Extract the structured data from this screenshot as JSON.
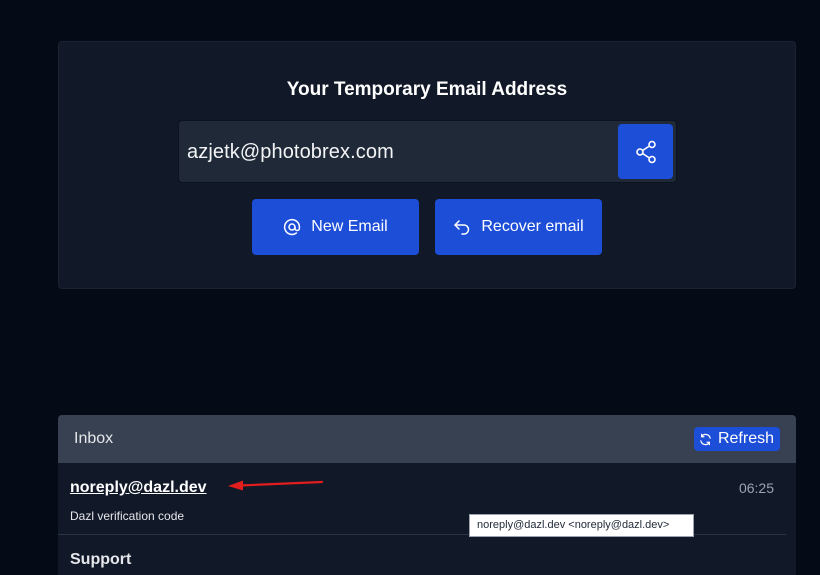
{
  "email_card": {
    "title": "Your Temporary Email Address",
    "address": "azjetk@photobrex.com",
    "share_icon": "share-icon",
    "new_email_label": "New Email",
    "new_email_icon": "at-icon",
    "recover_label": "Recover email",
    "recover_icon": "undo-arrow-icon"
  },
  "inbox": {
    "title": "Inbox",
    "refresh_label": "Refresh",
    "refresh_icon": "refresh-icon",
    "messages": [
      {
        "sender": "noreply@dazl.dev",
        "subject": "Dazl verification code",
        "time": "06:25"
      },
      {
        "sender": "Support"
      }
    ]
  },
  "tooltip": {
    "text": "noreply@dazl.dev <noreply@dazl.dev>"
  },
  "colors": {
    "page_background": "#050a17",
    "card_background": "#111827",
    "accent": "#1d4ed8",
    "inbox_header": "#374151",
    "annotation_arrow": "#e11d1d"
  }
}
